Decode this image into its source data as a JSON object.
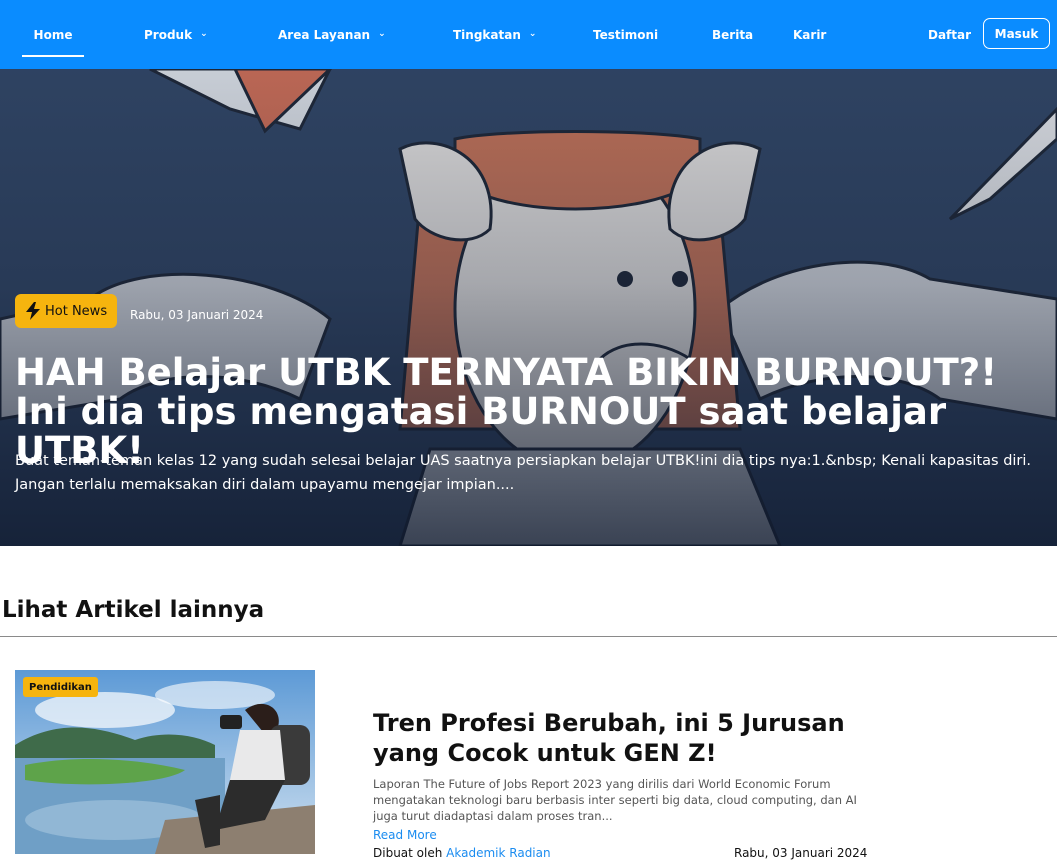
{
  "nav": {
    "home": "Home",
    "produk": "Produk",
    "area": "Area Layanan",
    "tingkatan": "Tingkatan",
    "testimoni": "Testimoni",
    "berita": "Berita",
    "karir": "Karir",
    "daftar": "Daftar",
    "masuk": "Masuk",
    "chevron_glyph": "⌄"
  },
  "hero": {
    "badge": "Hot News",
    "badge_icon": "lightning-icon",
    "date": "Rabu, 03 Januari 2024",
    "title": "HAH Belajar UTBK TERNYATA BIKIN BURNOUT?! Ini dia tips mengatasi BURNOUT saat belajar UTBK!",
    "excerpt": "Buat teman-teman kelas 12 yang sudah selesai belajar UAS saatnya persiapkan belajar UTBK!ini dia tips nya:1.&nbsp; Kenali kapasitas diri. Jangan terlalu memaksakan diri dalam upayamu mengejar impian...."
  },
  "section": {
    "title": "Lihat Artikel lainnya"
  },
  "article": {
    "category": "Pendidikan",
    "title": "Tren Profesi Berubah, ini 5 Jurusan yang Cocok untuk GEN Z!",
    "excerpt": "Laporan The Future of Jobs Report 2023 yang dirilis dari World Economic Forum mengatakan teknologi baru berbasis inter seperti big data, cloud computing, dan AI juga turut diadaptasi dalam proses tran...",
    "read_more": "Read More",
    "author_prefix": "Dibuat oleh",
    "author": "Akademik Radian",
    "date": "Rabu, 03 Januari 2024"
  },
  "colors": {
    "nav_bg": "#0a8cff",
    "badge": "#f6b40e",
    "link": "#1b8cf0"
  }
}
